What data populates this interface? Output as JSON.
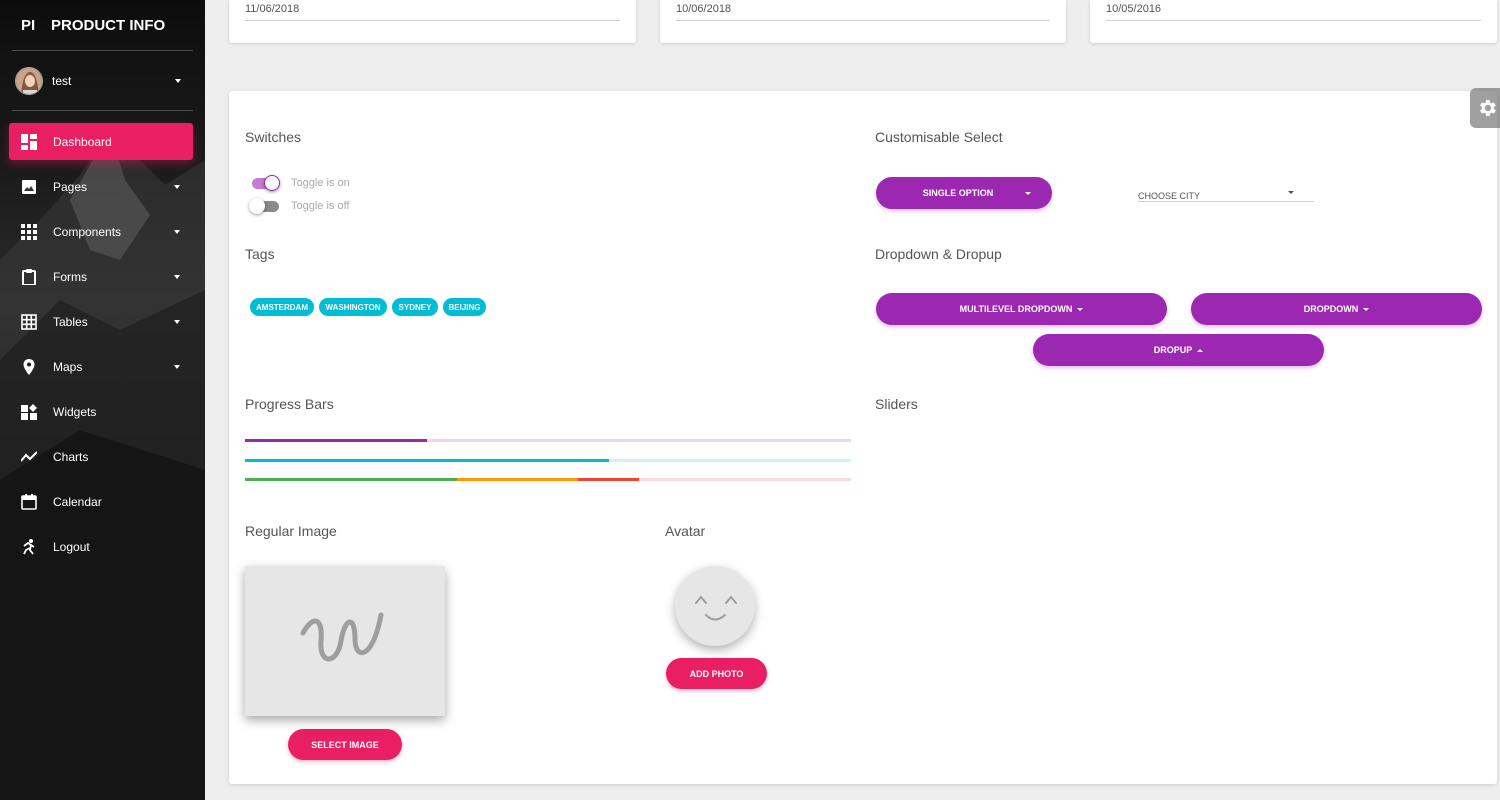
{
  "app": {
    "logo_mini": "PI",
    "title": "PRODUCT INFO"
  },
  "user": {
    "name": "test"
  },
  "sidebar": {
    "items": [
      {
        "label": "Dashboard",
        "icon": "dashboard-icon",
        "active": true,
        "has_caret": false
      },
      {
        "label": "Pages",
        "icon": "image-icon",
        "has_caret": true
      },
      {
        "label": "Components",
        "icon": "apps-icon",
        "has_caret": true
      },
      {
        "label": "Forms",
        "icon": "clipboard-icon",
        "has_caret": true
      },
      {
        "label": "Tables",
        "icon": "grid-icon",
        "has_caret": true
      },
      {
        "label": "Maps",
        "icon": "place-icon",
        "has_caret": true
      },
      {
        "label": "Widgets",
        "icon": "widgets-icon",
        "has_caret": false
      },
      {
        "label": "Charts",
        "icon": "timeline-icon",
        "has_caret": false
      },
      {
        "label": "Calendar",
        "icon": "calendar-icon",
        "has_caret": false
      },
      {
        "label": "Logout",
        "icon": "run-icon",
        "has_caret": false
      }
    ]
  },
  "top_cards": [
    {
      "date": "11/06/2018"
    },
    {
      "date": "10/06/2018"
    },
    {
      "date": "10/05/2016"
    }
  ],
  "switches": {
    "title": "Switches",
    "on_label": "Toggle is on",
    "off_label": "Toggle is off"
  },
  "tags": {
    "title": "Tags",
    "items": [
      "AMSTERDAM",
      "WASHINGTON",
      "SYDNEY",
      "BEIJING"
    ]
  },
  "progress": {
    "title": "Progress Bars",
    "bars": [
      {
        "color": "#9c27b0",
        "track": "#ecd5f0",
        "value": 0.3
      },
      {
        "color": "#00bcd4",
        "track": "#cdf2f7",
        "value": 0.6
      },
      {
        "segments": [
          {
            "color": "#4caf50",
            "value": 0.35
          },
          {
            "color": "#ff9800",
            "value": 0.2
          },
          {
            "color": "#f44336",
            "value": 0.1
          }
        ],
        "track": "#fbdcdc"
      }
    ]
  },
  "select": {
    "title": "Customisable Select",
    "single_option": "SINGLE OPTION",
    "choose_city": "CHOOSE CITY"
  },
  "dropdowns": {
    "title": "Dropdown & Dropup",
    "multilevel": "MULTILEVEL DROPDOWN",
    "dropdown": "DROPDOWN",
    "dropup": "DROPUP"
  },
  "sliders": {
    "title": "Sliders"
  },
  "regular_image": {
    "title": "Regular Image",
    "button": "SELECT IMAGE"
  },
  "avatar": {
    "title": "Avatar",
    "button": "ADD PHOTO"
  },
  "colors": {
    "primary": "#9c27b0",
    "rose": "#e91e63",
    "info": "#00bcd4"
  }
}
